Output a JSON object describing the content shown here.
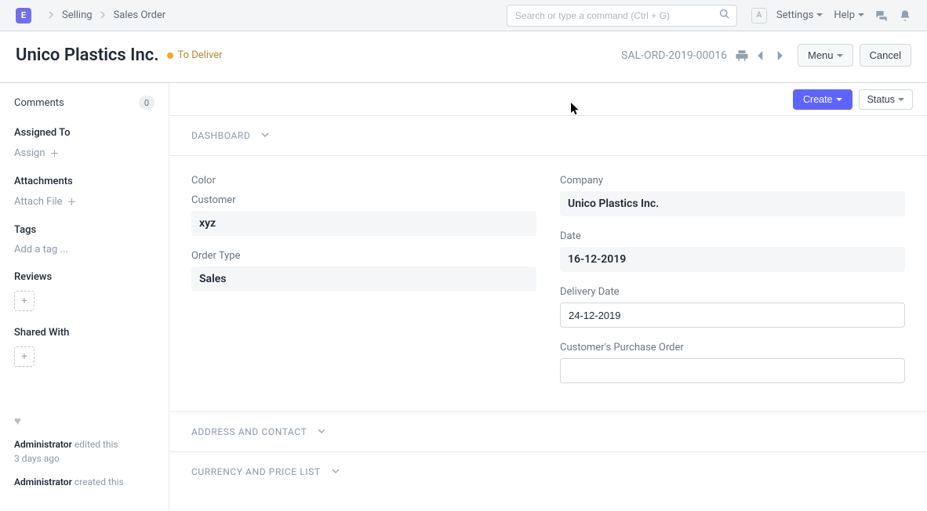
{
  "navbar": {
    "logo_letter": "E",
    "breadcrumbs": [
      "Selling",
      "Sales Order"
    ],
    "search_placeholder": "Search or type a command (Ctrl + G)",
    "avatar_letter": "A",
    "settings": "Settings",
    "help": "Help"
  },
  "header": {
    "title": "Unico Plastics Inc.",
    "status": "To Deliver",
    "doc_id": "SAL-ORD-2019-00016",
    "menu": "Menu",
    "cancel": "Cancel"
  },
  "sidebar": {
    "comments_label": "Comments",
    "comments_count": "0",
    "assigned_to_label": "Assigned To",
    "assign_action": "Assign",
    "attachments_label": "Attachments",
    "attach_action": "Attach File",
    "tags_label": "Tags",
    "tags_action": "Add a tag ...",
    "reviews_label": "Reviews",
    "shared_label": "Shared With",
    "log": [
      {
        "who": "Administrator",
        "action": " edited this ",
        "when": "3 days ago"
      },
      {
        "who": "Administrator",
        "action": " created this",
        "when": ""
      }
    ]
  },
  "toolbar": {
    "create": "Create",
    "status": "Status"
  },
  "sections": {
    "dashboard": "DASHBOARD",
    "address": "ADDRESS AND CONTACT",
    "currency": "CURRENCY AND PRICE LIST"
  },
  "fields": {
    "col1": {
      "color_label": "Color",
      "customer_label": "Customer",
      "customer_value": "xyz",
      "order_type_label": "Order Type",
      "order_type_value": "Sales"
    },
    "col2": {
      "company_label": "Company",
      "company_value": "Unico Plastics Inc.",
      "date_label": "Date",
      "date_value": "16-12-2019",
      "delivery_date_label": "Delivery Date",
      "delivery_date_value": "24-12-2019",
      "cpo_label": "Customer's Purchase Order",
      "cpo_value": ""
    }
  }
}
